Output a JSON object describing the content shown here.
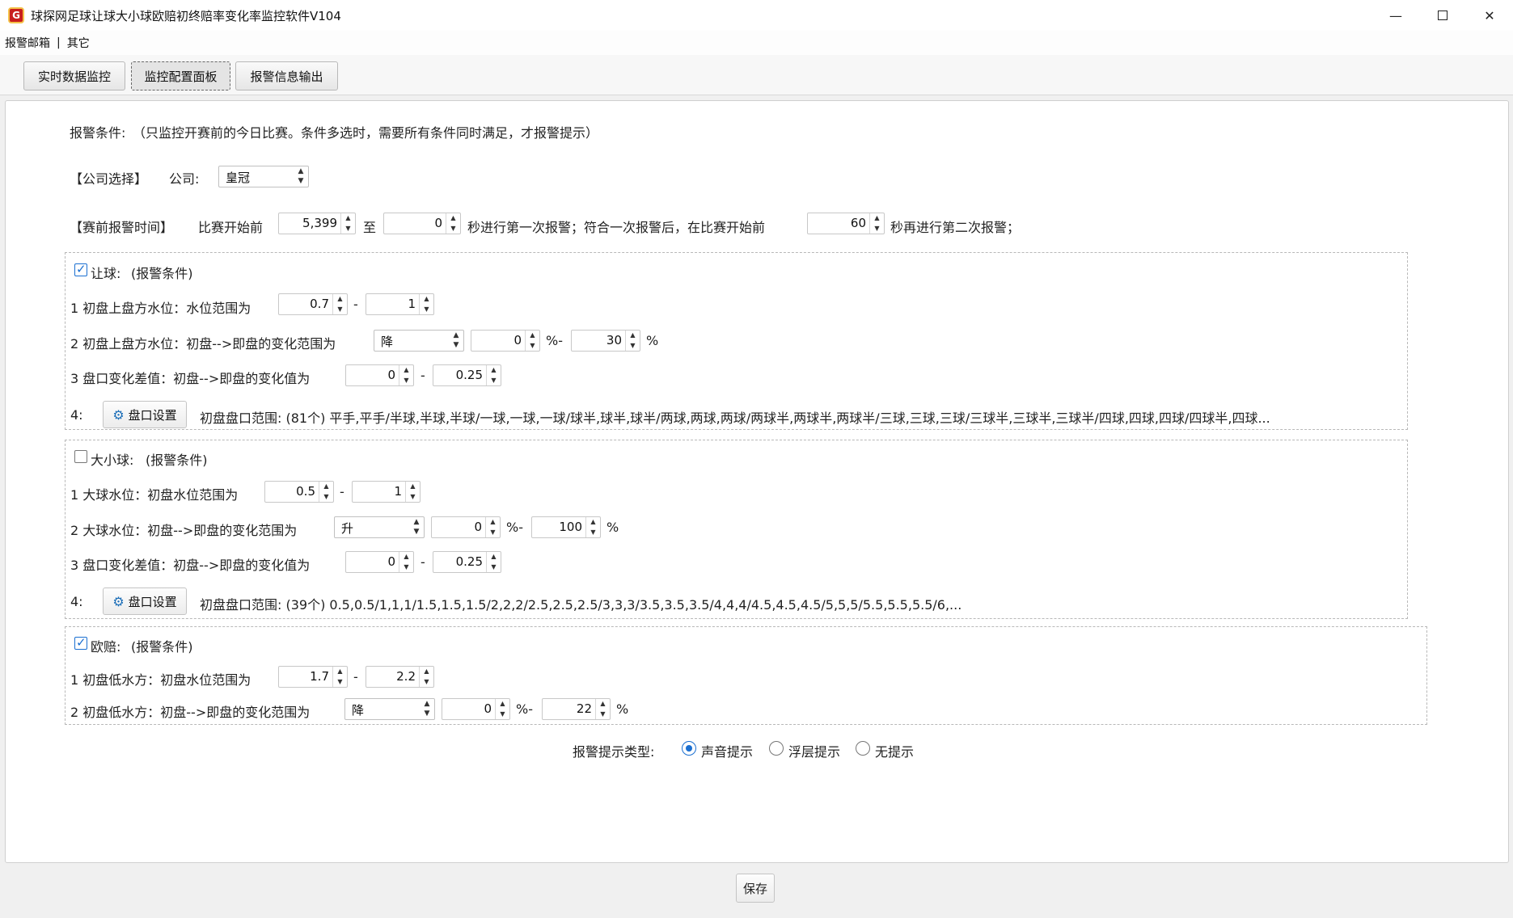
{
  "window": {
    "title": "球探网足球让球大小球欧赔初终赔率变化率监控软件V104",
    "icon_text": "G"
  },
  "menu": {
    "items": [
      "报警邮箱",
      "其它"
    ],
    "separator": "|"
  },
  "tabs": [
    {
      "label": "实时数据监控"
    },
    {
      "label": "监控配置面板"
    },
    {
      "label": "报警信息输出"
    }
  ],
  "alarm_header": {
    "title": "报警条件:",
    "note": "（只监控开赛前的今日比赛。条件多选时，需要所有条件同时满足，才报警提示）"
  },
  "company": {
    "section": "【公司选择】",
    "label": "公司:",
    "selected": "皇冠"
  },
  "pre_match": {
    "section": "【赛前报警时间】",
    "before_label": "比赛开始前",
    "value1": "5,399",
    "to_label": "至",
    "value2": "0",
    "mid_text": "秒进行第一次报警；符合一次报警后，在比赛开始前",
    "value3": "60",
    "end_text": "秒再进行第二次报警；"
  },
  "handicap": {
    "checked": true,
    "title": "让球:",
    "subtitle": "(报警条件)",
    "row1": {
      "label": "1 初盘上盘方水位：水位范围为",
      "min": "0.7",
      "dash": "-",
      "max": "1"
    },
    "row2": {
      "label": "2 初盘上盘方水位：初盘-->即盘的变化范围为",
      "direction": "降",
      "min": "0",
      "pct_dash": "%-",
      "max": "30",
      "pct": "%"
    },
    "row3": {
      "label": "3 盘口变化差值：初盘-->即盘的变化值为",
      "min": "0",
      "dash": "-",
      "max": "0.25"
    },
    "row4": {
      "label": "4:",
      "button": "盘口设置",
      "range_text": "初盘盘口范围: (81个) 平手,平手/半球,半球,半球/一球,一球,一球/球半,球半,球半/两球,两球,两球/两球半,两球半,两球半/三球,三球,三球/三球半,三球半,三球半/四球,四球,四球/四球半,四球..."
    }
  },
  "overunder": {
    "checked": false,
    "title": "大小球:",
    "subtitle": "(报警条件)",
    "row1": {
      "label": "1 大球水位：初盘水位范围为",
      "min": "0.5",
      "dash": "-",
      "max": "1"
    },
    "row2": {
      "label": "2  大球水位：初盘-->即盘的变化范围为",
      "direction": "升",
      "min": "0",
      "pct_dash": "%-",
      "max": "100",
      "pct": "%"
    },
    "row3": {
      "label": "3 盘口变化差值：初盘-->即盘的变化值为",
      "min": "0",
      "dash": "-",
      "max": "0.25"
    },
    "row4": {
      "label": "4:",
      "button": "盘口设置",
      "range_text": "初盘盘口范围: (39个) 0.5,0.5/1,1,1/1.5,1.5,1.5/2,2,2/2.5,2.5,2.5/3,3,3/3.5,3.5,3.5/4,4,4/4.5,4.5,4.5/5,5,5/5.5,5.5,5.5/6,..."
    }
  },
  "european": {
    "checked": true,
    "title": "欧赔:",
    "subtitle": "(报警条件)",
    "row1": {
      "label": "1 初盘低水方：初盘水位范围为",
      "min": "1.7",
      "dash": "-",
      "max": "2.2"
    },
    "row2": {
      "label": "2 初盘低水方：初盘-->即盘的变化范围为",
      "direction": "降",
      "min": "0",
      "pct_dash": "%-",
      "max": "22",
      "pct": "%"
    }
  },
  "alert_type": {
    "label": "报警提示类型:",
    "options": [
      "声音提示",
      "浮层提示",
      "无提示"
    ],
    "selected": "声音提示"
  },
  "save_button": "保存",
  "colors": {
    "accent": "#1a6fd1",
    "alarm_red": "#e0141e"
  },
  "icons": [
    "minimize-icon",
    "maximize-icon",
    "close-icon",
    "gear-icon"
  ]
}
